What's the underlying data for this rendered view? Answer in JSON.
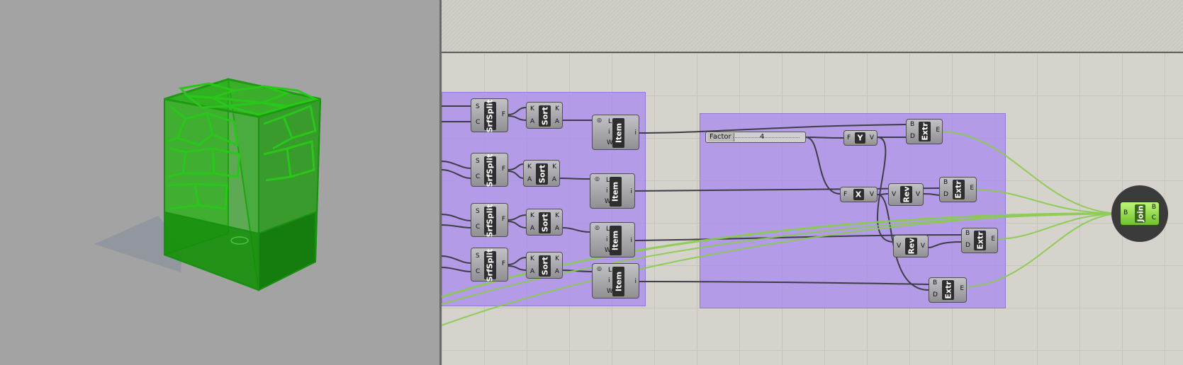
{
  "canvas": {
    "slider": {
      "name": "Factor",
      "value": "4"
    },
    "components": [
      {
        "id": "srfsplit-1",
        "label": "SrfSplit",
        "inputs": [
          "S",
          "C"
        ],
        "outputs": [
          "F"
        ]
      },
      {
        "id": "srfsplit-2",
        "label": "SrfSplit",
        "inputs": [
          "S",
          "C"
        ],
        "outputs": [
          "F"
        ]
      },
      {
        "id": "srfsplit-3",
        "label": "SrfSplit",
        "inputs": [
          "S",
          "C"
        ],
        "outputs": [
          "F"
        ]
      },
      {
        "id": "srfsplit-4",
        "label": "SrfSplit",
        "inputs": [
          "S",
          "C"
        ],
        "outputs": [
          "F"
        ]
      },
      {
        "id": "sort-1",
        "label": "Sort",
        "inputs": [
          "K",
          "A"
        ],
        "outputs": [
          "K",
          "A"
        ]
      },
      {
        "id": "sort-2",
        "label": "Sort",
        "inputs": [
          "K",
          "A"
        ],
        "outputs": [
          "K",
          "A"
        ]
      },
      {
        "id": "sort-3",
        "label": "Sort",
        "inputs": [
          "K",
          "A"
        ],
        "outputs": [
          "K",
          "A"
        ]
      },
      {
        "id": "sort-4",
        "label": "Sort",
        "inputs": [
          "K",
          "A"
        ],
        "outputs": [
          "K",
          "A"
        ]
      },
      {
        "id": "item-1",
        "label": "Item",
        "inputs": [
          "L",
          "i",
          "W"
        ],
        "outputs": [
          "i"
        ]
      },
      {
        "id": "item-2",
        "label": "Item",
        "inputs": [
          "L",
          "i",
          "W"
        ],
        "outputs": [
          "i"
        ]
      },
      {
        "id": "item-3",
        "label": "Item",
        "inputs": [
          "L",
          "i",
          "W"
        ],
        "outputs": [
          "i"
        ]
      },
      {
        "id": "item-4",
        "label": "Item",
        "inputs": [
          "L",
          "i",
          "W"
        ],
        "outputs": [
          "i"
        ]
      },
      {
        "id": "y-vec",
        "label": "Y",
        "inputs": [
          "F"
        ],
        "outputs": [
          "V"
        ]
      },
      {
        "id": "x-vec",
        "label": "X",
        "inputs": [
          "F"
        ],
        "outputs": [
          "V"
        ]
      },
      {
        "id": "rev-1",
        "label": "Rev",
        "inputs": [
          "V"
        ],
        "outputs": [
          "V"
        ]
      },
      {
        "id": "rev-2",
        "label": "Rev",
        "inputs": [
          "V"
        ],
        "outputs": [
          "V"
        ]
      },
      {
        "id": "extr-1",
        "label": "Extr",
        "inputs": [
          "B",
          "D"
        ],
        "outputs": [
          "E"
        ]
      },
      {
        "id": "extr-2",
        "label": "Extr",
        "inputs": [
          "B",
          "D"
        ],
        "outputs": [
          "E"
        ]
      },
      {
        "id": "extr-3",
        "label": "Extr",
        "inputs": [
          "B",
          "D"
        ],
        "outputs": [
          "E"
        ]
      },
      {
        "id": "extr-4",
        "label": "Extr",
        "inputs": [
          "B",
          "D"
        ],
        "outputs": [
          "E"
        ]
      }
    ],
    "join": {
      "label": "Join",
      "inputs": [
        "B"
      ],
      "outputs": [
        "B",
        "C"
      ]
    }
  },
  "colors": {
    "viewport": "#a3a3a3",
    "canvas": "#d6d3cd",
    "group": "#aa8cf0",
    "wire": "#3d3d45",
    "preview_wire": "#86cc4a",
    "model": "#26b014"
  }
}
